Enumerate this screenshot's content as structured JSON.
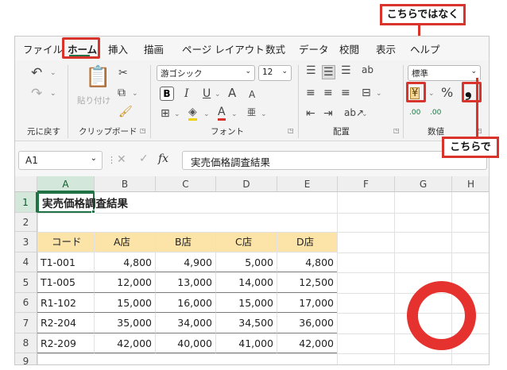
{
  "menu": {
    "tabs": [
      "ファイル",
      "ホーム",
      "挿入",
      "描画",
      "ページ レイアウト",
      "数式",
      "データ",
      "校閲",
      "表示",
      "ヘルプ"
    ],
    "active_tab": "ホーム"
  },
  "ribbon": {
    "undo_group_label": "元に戻す",
    "clipboard": {
      "paste_label": "貼り付け",
      "group_label": "クリップボード"
    },
    "font": {
      "font_name": "游ゴシック",
      "font_size": "12",
      "bold": "B",
      "italic": "I",
      "underline": "U",
      "grow": "A",
      "shrink": "A",
      "font_color": "A",
      "furigana": "亜",
      "group_label": "フォント"
    },
    "alignment": {
      "group_label": "配置"
    },
    "number": {
      "format": "標準",
      "percent": "%",
      "comma": "❟",
      "inc_decimal": ".00",
      "dec_decimal": ".00",
      "group_label": "数値"
    }
  },
  "formula_bar": {
    "name_box": "A1",
    "fx": "fx",
    "content": "実売価格調査結果"
  },
  "sheet": {
    "columns": [
      "A",
      "B",
      "C",
      "D",
      "E",
      "F",
      "G",
      "H"
    ],
    "rows": [
      "1",
      "2",
      "3",
      "4",
      "5",
      "6",
      "7",
      "8",
      "9"
    ],
    "title": "実売価格調査結果",
    "headers": [
      "コード",
      "A店",
      "B店",
      "C店",
      "D店"
    ],
    "data": [
      [
        "T1-001",
        "4,800",
        "4,900",
        "5,000",
        "4,800"
      ],
      [
        "T1-005",
        "12,000",
        "13,000",
        "14,000",
        "12,500"
      ],
      [
        "R1-102",
        "15,000",
        "16,000",
        "15,000",
        "17,000"
      ],
      [
        "R2-204",
        "35,000",
        "34,000",
        "34,500",
        "36,000"
      ],
      [
        "R2-209",
        "42,000",
        "40,000",
        "41,000",
        "42,000"
      ]
    ]
  },
  "annotations": {
    "not_this": "こちらではなく",
    "this_one": "こちらで",
    "accent": "#d9342b"
  }
}
